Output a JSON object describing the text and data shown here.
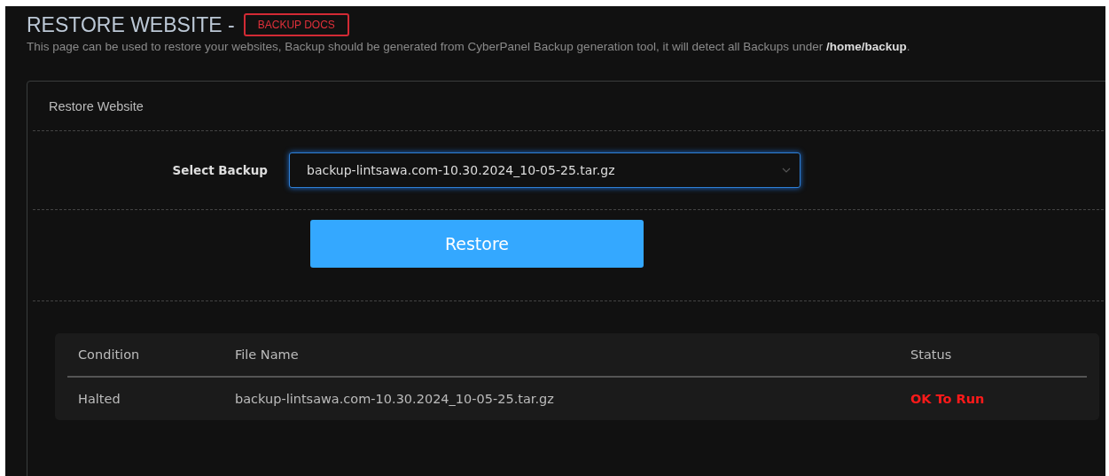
{
  "header": {
    "title": "RESTORE WEBSITE -",
    "docs_link": "BACKUP DOCS",
    "description": "This page can be used to restore your websites, Backup should be generated from CyberPanel Backup generation tool, it will detect all Backups under **/home/backup**."
  },
  "card": {
    "title": "Restore Website",
    "select_label": "Select Backup",
    "select_value": "backup-lintsawa.com-10.30.2024_10-05-25.tar.gz",
    "button": "Restore"
  },
  "table": {
    "columns": [
      "Condition",
      "File Name",
      "Status"
    ],
    "rows": [
      [
        "Halted",
        "backup-lintsawa.com-10.30.2024_10-05-25.tar.gz",
        "OK To Run"
      ]
    ]
  }
}
